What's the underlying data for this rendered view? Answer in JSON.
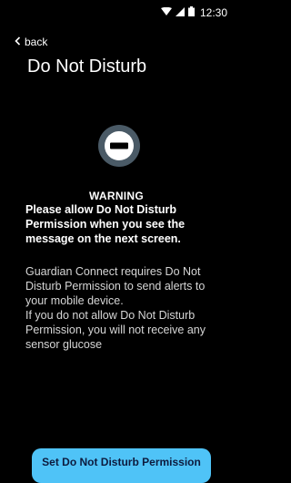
{
  "status_bar": {
    "time": "12:30",
    "icons": [
      "wifi-icon",
      "signal-icon",
      "battery-icon"
    ]
  },
  "nav": {
    "back_label": "back",
    "back_icon": "chevron-left-icon"
  },
  "page": {
    "title": "Do Not Disturb"
  },
  "status_icon": "do-not-disturb-icon",
  "warning": {
    "heading": "WARNING",
    "message": "Please allow Do Not Disturb Permission when you see the message on the next screen."
  },
  "description": {
    "paragraph_1": "Guardian Connect requires Do Not Disturb Permission to send alerts to your mobile device.",
    "paragraph_2": "If you do not allow Do Not Disturb Permission, you will not receive any sensor glucose"
  },
  "actions": {
    "primary_label": "Set Do Not Disturb Permission"
  },
  "colors": {
    "background": "#000000",
    "text": "#ffffff",
    "muted_text": "#d6d6d6",
    "button": "#4fc3f7",
    "button_text": "#0d1b3e",
    "icon_ring": "#4a5a66"
  }
}
